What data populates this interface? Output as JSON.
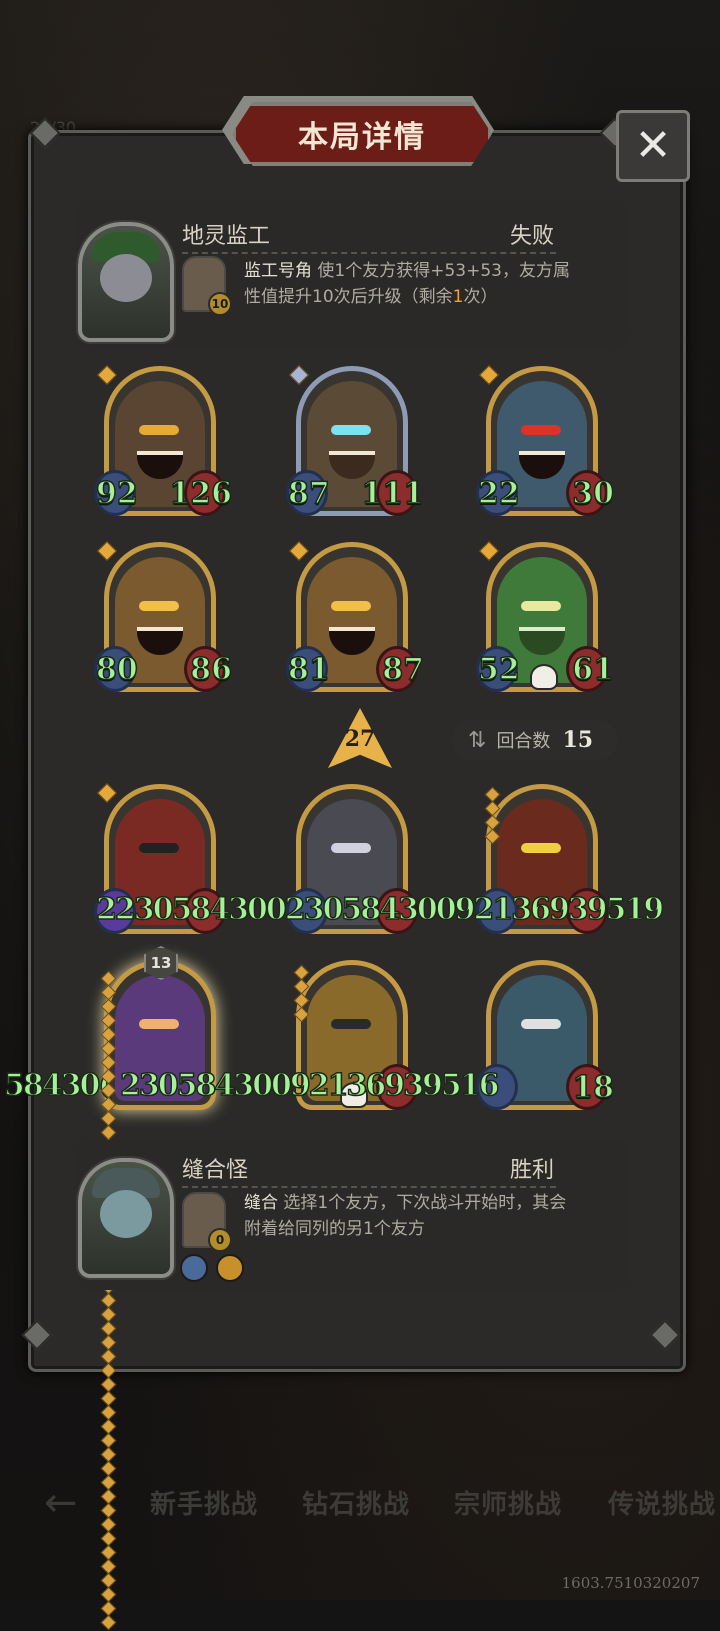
{
  "panel": {
    "title": "本局详情"
  },
  "background": {
    "top_counter": "20/30"
  },
  "opponent": {
    "name": "地灵监工",
    "result": "失败",
    "item": {
      "name": "监工号角",
      "desc_pre": "使1个友方获得+53+53，友方属性值提升10次后升级（剩余",
      "desc_hl": "1",
      "desc_post": "次）",
      "level": "10"
    }
  },
  "opponent_units": [
    {
      "attack": "92",
      "health": "126"
    },
    {
      "attack": "87",
      "health": "111"
    },
    {
      "attack": "22",
      "health": "30"
    },
    {
      "attack": "80",
      "health": "86"
    },
    {
      "attack": "81",
      "health": "87"
    },
    {
      "attack": "52",
      "health": "61"
    }
  ],
  "vs": {
    "value": "27"
  },
  "round": {
    "label": "回合数",
    "value": "15"
  },
  "player_units_row1": {
    "overflow_text": "2230584300230584300921369395​19"
  },
  "player_units_row2": {
    "overflow_left": "58430(",
    "overflow_text": "2305843009213693951​6",
    "last_health": "18",
    "level_badge": "13"
  },
  "self": {
    "name": "缝合怪",
    "result": "胜利",
    "item": {
      "name": "缝合",
      "desc": "选择1个友方，下次战斗开始时，其会附着给同列的另1个友方",
      "level": "0"
    }
  },
  "bottom_nav": {
    "items": [
      "新手挑战",
      "钻石挑战",
      "宗师挑战",
      "传说挑战"
    ]
  },
  "footer": {
    "coords": "1603.7510320207"
  },
  "colors": {
    "accent": "#c59a45",
    "stat_green": "#a6f09a",
    "title_red": "#6d1d17"
  }
}
